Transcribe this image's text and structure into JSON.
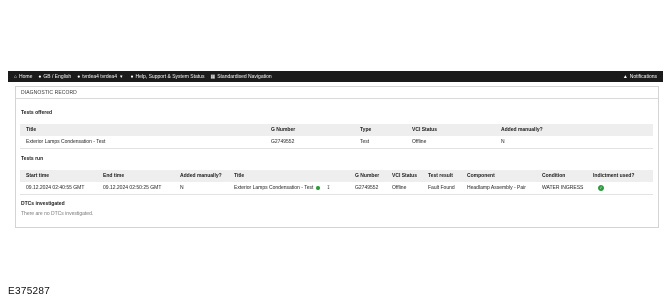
{
  "nav": {
    "home": "Home",
    "locale": "GB / English",
    "user": "tvrdea4 tvrdea4",
    "help": "Help, Support & System Status",
    "standardised": "Standardised Navigation",
    "notifications": "Notifications"
  },
  "panel": {
    "title": "DIAGNOSTIC RECORD",
    "tests_offered_heading": "Tests offered",
    "tests_offered": {
      "columns": [
        "Title",
        "G Number",
        "Type",
        "VCI Status",
        "Added manually?"
      ],
      "rows": [
        [
          "Exterior Lamps Condensation - Test",
          "G2749552",
          "Test",
          "Offline",
          "N"
        ]
      ]
    },
    "tests_run_heading": "Tests run",
    "tests_run": {
      "columns": [
        "Start time",
        "End time",
        "Added manually?",
        "Title",
        "G Number",
        "VCI Status",
        "Test result",
        "Component",
        "Condition",
        "Indictment used?"
      ],
      "rows": [
        [
          "09.12.2024 02:40:55 GMT",
          "09.12.2024 02:50:25 GMT",
          "N",
          "Exterior Lamps Condensation - Test",
          "G2749552",
          "Offline",
          "Fault Found",
          "Headlamp Assembly - Pair",
          "WATER INGRESS",
          ""
        ]
      ]
    },
    "dtcs_heading": "DTCs investigated",
    "dtcs_note": "There are no DTCs investigated."
  },
  "figure_id": "E375287",
  "colors": {
    "topbar": "#1b1b1b",
    "success": "#2e9a3e",
    "header_bg": "#eeeeee"
  }
}
